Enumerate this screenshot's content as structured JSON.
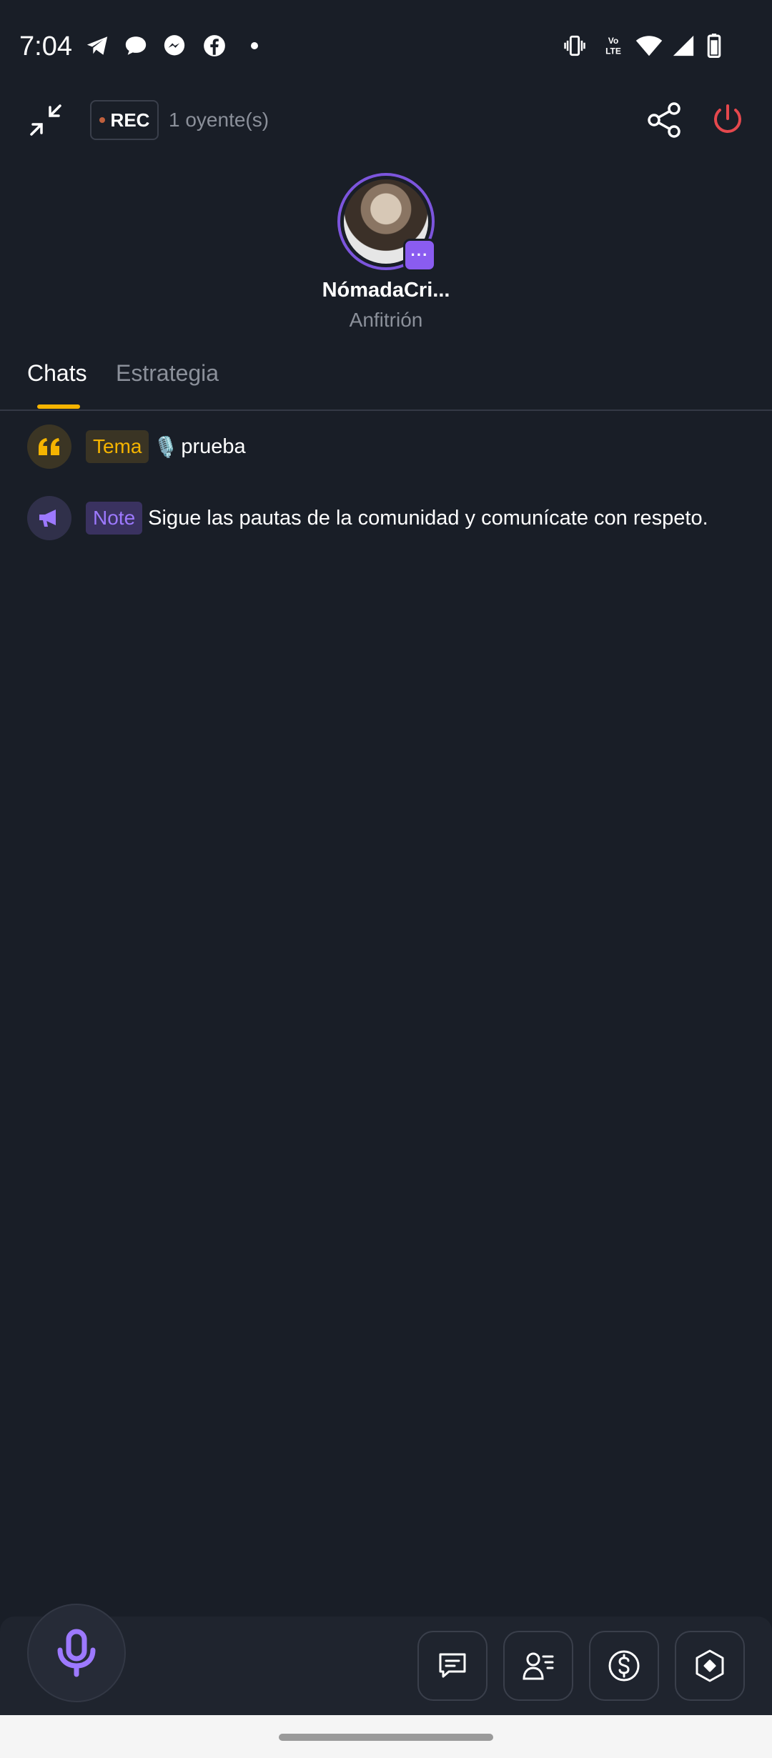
{
  "status_bar": {
    "time": "7:04",
    "left_icons": [
      "telegram-icon",
      "chat-bubble-icon",
      "messenger-icon",
      "facebook-icon",
      "dot-icon"
    ],
    "right_icons": [
      "vibrate-icon",
      "volte-icon",
      "wifi-icon",
      "signal-icon",
      "battery-icon"
    ],
    "volte_label": "Vo LTE"
  },
  "top_bar": {
    "rec_label": "REC",
    "listeners": "1 oyente(s)"
  },
  "host": {
    "name": "NómadaCri...",
    "role": "Anfitrión",
    "more_label": "···"
  },
  "tabs": [
    {
      "label": "Chats",
      "active": true
    },
    {
      "label": "Estrategia",
      "active": false
    }
  ],
  "messages": [
    {
      "tag": "Tema",
      "emoji": "🎙️",
      "text": "prueba",
      "icon": "quote-icon"
    },
    {
      "tag": "Note",
      "text": "Sigue las pautas de la comunidad y comunícate con respeto.",
      "icon": "megaphone-icon"
    }
  ],
  "bottom_actions": [
    "message-icon",
    "user-list-icon",
    "dollar-icon",
    "hexagon-diamond-icon"
  ],
  "colors": {
    "background": "#191e27",
    "accent_yellow": "#f5b400",
    "accent_purple": "#8a5cf0",
    "power_red": "#e5484d"
  }
}
